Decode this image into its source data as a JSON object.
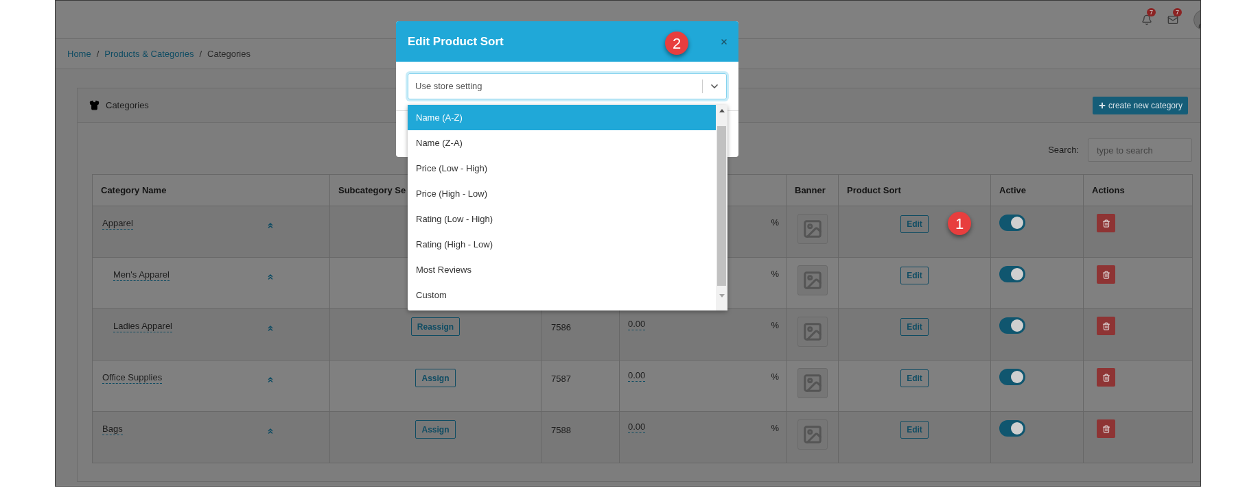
{
  "topbar": {
    "notifications": {
      "count": "7"
    },
    "messages": {
      "count": "7"
    }
  },
  "breadcrumb": [
    {
      "kind": "link",
      "label": "Home"
    },
    {
      "kind": "separator",
      "label": "/"
    },
    {
      "kind": "link",
      "label": "Products & Categories"
    },
    {
      "kind": "separator",
      "label": "/"
    },
    {
      "kind": "current",
      "label": "Categories"
    }
  ],
  "card": {
    "title": "Categories",
    "create_button": "create new category",
    "search": {
      "label": "Search:",
      "placeholder": "type to search"
    }
  },
  "table": {
    "columns": [
      "Category Name",
      "Subcategory Se",
      "Banner",
      "Product Sort",
      "Active",
      "Actions"
    ],
    "rows": [
      {
        "name": "Apparel",
        "unit": "%",
        "sort_button": "Edit",
        "annotation": "1",
        "active": true,
        "children": [
          {
            "name": "Men's Apparel",
            "unit": "%",
            "sort_button": "Edit",
            "active": true
          },
          {
            "name": "Ladies Apparel",
            "subcategory_button": "Reassign",
            "id": "7586",
            "value": "0.00",
            "unit": "%",
            "sort_button": "Edit",
            "active": true
          }
        ]
      },
      {
        "name": "Office Supplies",
        "subcategory_button": "Assign",
        "id": "7587",
        "value": "0.00",
        "unit": "%",
        "sort_button": "Edit",
        "active": true
      },
      {
        "name": "Bags",
        "subcategory_button": "Assign",
        "id": "7588",
        "value": "0.00",
        "unit": "%",
        "sort_button": "Edit",
        "active": true
      }
    ]
  },
  "modal": {
    "title": "Edit Product Sort",
    "annotation": "2",
    "select": {
      "value": "Use store setting"
    },
    "options": [
      {
        "label": "Name (A-Z)",
        "selected": true
      },
      {
        "label": "Name (Z-A)",
        "selected": false
      },
      {
        "label": "Price (Low - High)",
        "selected": false
      },
      {
        "label": "Price (High - Low)",
        "selected": false
      },
      {
        "label": "Rating (Low - High)",
        "selected": false
      },
      {
        "label": "Rating (High - Low)",
        "selected": false
      },
      {
        "label": "Most Reviews",
        "selected": false
      },
      {
        "label": "Custom",
        "selected": false
      }
    ]
  }
}
